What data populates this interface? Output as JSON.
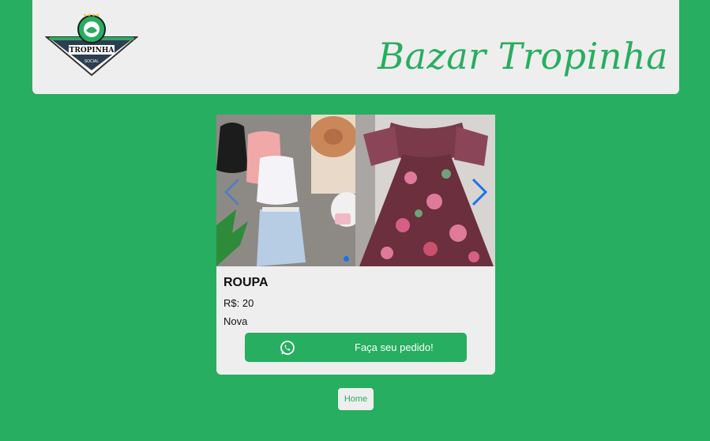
{
  "header": {
    "logo_text": "TROPINHA",
    "logo_subtext": "SOCIAL",
    "site_title": "Bazar Tropinha"
  },
  "product": {
    "name": "ROUPA",
    "price": "R$: 20",
    "condition": "Nova",
    "order_label": "Faça seu pedido!"
  },
  "carousel": {
    "arrow_color": "#1a73e8",
    "active_index": 1
  },
  "footer": {
    "home_label": "Home"
  },
  "colors": {
    "brand_green": "#27ae60",
    "panel_bg": "#eeeeee"
  }
}
